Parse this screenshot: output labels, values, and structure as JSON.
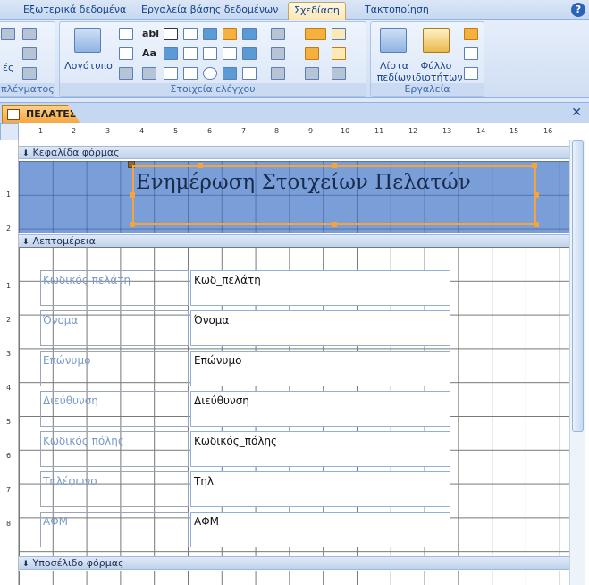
{
  "ribbon_tabs": [
    "Εξωτερικά δεδομένα",
    "Εργαλεία βάσης δεδομένων",
    "Σχεδίαση",
    "Τακτοποίηση"
  ],
  "active_tab": "Σχεδίαση",
  "help_label": "?",
  "groups": {
    "gridlines": {
      "label": "πλέγματος",
      "partial_text": "ές"
    },
    "controls": {
      "label": "Στοιχεία ελέγχου",
      "logo_label": "Λογότυπο",
      "text_label": "abl",
      "aa_label": "Aa"
    },
    "tools": {
      "label": "Εργαλεία",
      "field_list_label": "Λίστα πεδίων",
      "property_sheet_label": "Φύλλο ιδιοτήτων"
    }
  },
  "document": {
    "tab_label": "ΠΕΛΑΤΕΣ",
    "close": "✕"
  },
  "ruler": {
    "top_numbers": [
      "1",
      "2",
      "3",
      "4",
      "5",
      "6",
      "7",
      "8",
      "9",
      "10",
      "11",
      "12",
      "13",
      "14",
      "15",
      "16"
    ],
    "left_header_numbers": [
      "1",
      "2"
    ],
    "left_detail_numbers": [
      "1",
      "2",
      "3",
      "4",
      "5",
      "6",
      "7",
      "8"
    ]
  },
  "sections": {
    "header": "Κεφαλίδα φόρμας",
    "detail": "Λεπτομέρεια",
    "footer": "Υποσέλιδο φόρμας"
  },
  "form_title": "Ενημέρωση Στοιχείων Πελατών",
  "fields": [
    {
      "label": "Κωδικός πελάτη",
      "value": "Κωδ_πελάτη"
    },
    {
      "label": "Όνομα",
      "value": "Όνομα"
    },
    {
      "label": "Επώνυμο",
      "value": "Επώνυμο"
    },
    {
      "label": "Διεύθυνση",
      "value": "Διεύθυνση"
    },
    {
      "label": "Κωδικός πόλης",
      "value": "Κωδικός_πόλης"
    },
    {
      "label": "Τηλέφωνο",
      "value": "Τηλ"
    },
    {
      "label": "ΑΦΜ",
      "value": "ΑΦΜ"
    }
  ]
}
